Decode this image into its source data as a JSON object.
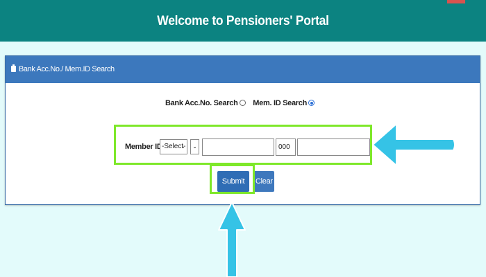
{
  "header": {
    "title": "Welcome to Pensioners' Portal"
  },
  "panel": {
    "header_label": "Bank Acc.No./ Mem.ID Search"
  },
  "search_type": {
    "options": [
      {
        "label": "Bank Acc.No. Search",
        "selected": false
      },
      {
        "label": "Mem. ID Search",
        "selected": true
      }
    ]
  },
  "member_id": {
    "label": "Member ID:",
    "region_select": "-Select-",
    "office_select": "",
    "establishment_value": "",
    "extension_value": "000",
    "account_value": ""
  },
  "buttons": {
    "submit_label": "Submit",
    "clear_label": "Clear"
  },
  "colors": {
    "header_bg": "#0c8381",
    "panel_header_bg": "#3c78bd",
    "highlight": "#7ee82a",
    "arrow": "#35c3e6",
    "page_bg": "#e3fbfb"
  }
}
